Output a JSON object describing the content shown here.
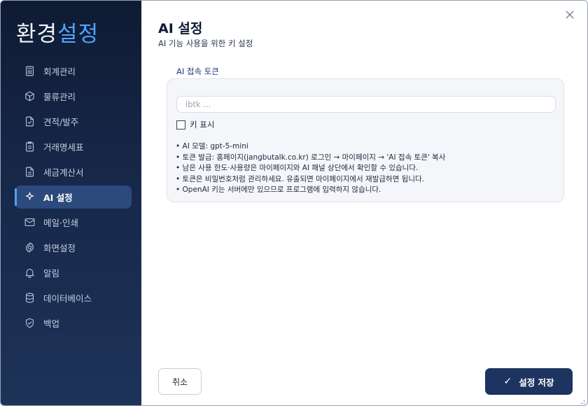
{
  "brand": {
    "part1": "환경",
    "part2": "설정",
    "accent_color": "#4ea3ff"
  },
  "sidebar": {
    "items": [
      {
        "label": "회계관리",
        "icon": "calculator-icon"
      },
      {
        "label": "물류관리",
        "icon": "box-icon"
      },
      {
        "label": "견적/발주",
        "icon": "file-check-icon"
      },
      {
        "label": "거래명세표",
        "icon": "clipboard-icon"
      },
      {
        "label": "세금계산서",
        "icon": "document-icon"
      },
      {
        "label": "AI 설정",
        "icon": "sparkle-icon",
        "active": true
      },
      {
        "label": "메일·인쇄",
        "icon": "mail-icon"
      },
      {
        "label": "화면설정",
        "icon": "gear-icon"
      },
      {
        "label": "알림",
        "icon": "bell-icon"
      },
      {
        "label": "데이터베이스",
        "icon": "database-icon"
      },
      {
        "label": "백업",
        "icon": "shield-icon"
      }
    ]
  },
  "header": {
    "title": "AI 설정",
    "subtitle": "AI 기능 사용을 위한 키 설정"
  },
  "token_section": {
    "label": "AI 접속 토큰",
    "input_value": "",
    "input_placeholder": "ibtk ...",
    "show_key_label": "키 표시",
    "show_key_checked": false,
    "info": [
      "AI 모델: gpt-5-mini",
      "토큰 발급: 홈페이지(jangbutalk.co.kr) 로그인 → 마이페이지 → 'AI 접속 토큰' 복사",
      "남은 사용 한도·사용량은 마이페이지와 AI 패널 상단에서 확인할 수 있습니다.",
      "토큰은 비밀번호처럼 관리하세요. 유출되면 마이페이지에서 재발급하면 됩니다.",
      "OpenAI 키는 서버에만 있으므로 프로그램에 입력하지 않습니다."
    ]
  },
  "footer": {
    "cancel_label": "취소",
    "save_label": "설정 저장",
    "save_icon": "checkmark-icon",
    "save_color": "#1d3460"
  }
}
